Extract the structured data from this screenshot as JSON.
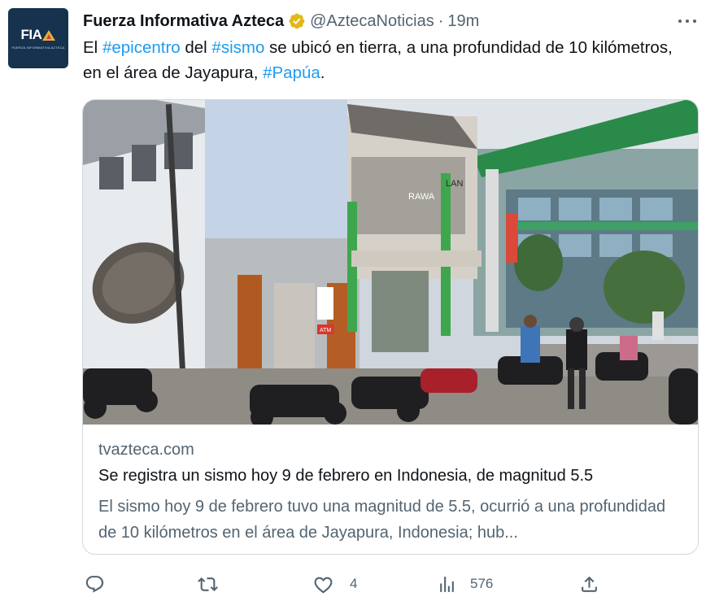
{
  "tweet": {
    "avatar": {
      "logo_text": "FIA",
      "subtitle": "FUERZA INFORMATIVA AZTECA",
      "icon": "fia-logo"
    },
    "author_name": "Fuerza Informativa Azteca",
    "verified_icon": "verified-badge-icon",
    "handle": "@AztecaNoticias",
    "separator": "·",
    "time": "19m",
    "more_icon": "more-icon",
    "text": {
      "p1": "El ",
      "tag1": "#epicentro",
      "p2": " del ",
      "tag2": "#sismo",
      "p3": " se ubicó en tierra, a una profundidad de 10 kilómetros, en el área de Jayapura, ",
      "tag3": "#Papúa",
      "p4": "."
    }
  },
  "card": {
    "image_alt": "Edificio dañado por el sismo en Jayapura",
    "signs": {
      "s1": "RAWA",
      "s2": "LAN",
      "s3": "ATM"
    },
    "domain": "tvazteca.com",
    "title": "Se registra un sismo hoy 9 de febrero en Indonesia, de magnitud 5.5",
    "description": "El sismo hoy 9 de febrero tuvo una magnitud de 5.5, ocurrió a una profundidad de 10 kilómetros en el área de Jayapura, Indonesia; hub..."
  },
  "actions": {
    "reply": {
      "icon": "reply-icon",
      "count": ""
    },
    "retweet": {
      "icon": "retweet-icon",
      "count": ""
    },
    "like": {
      "icon": "heart-icon",
      "count": "4"
    },
    "views": {
      "icon": "views-icon",
      "count": "576"
    },
    "share": {
      "icon": "share-icon",
      "count": ""
    }
  },
  "colors": {
    "link": "#1d9bf0",
    "muted": "#536471",
    "text": "#0f1419",
    "verified": "#e2b719",
    "border": "#cfd9de"
  }
}
